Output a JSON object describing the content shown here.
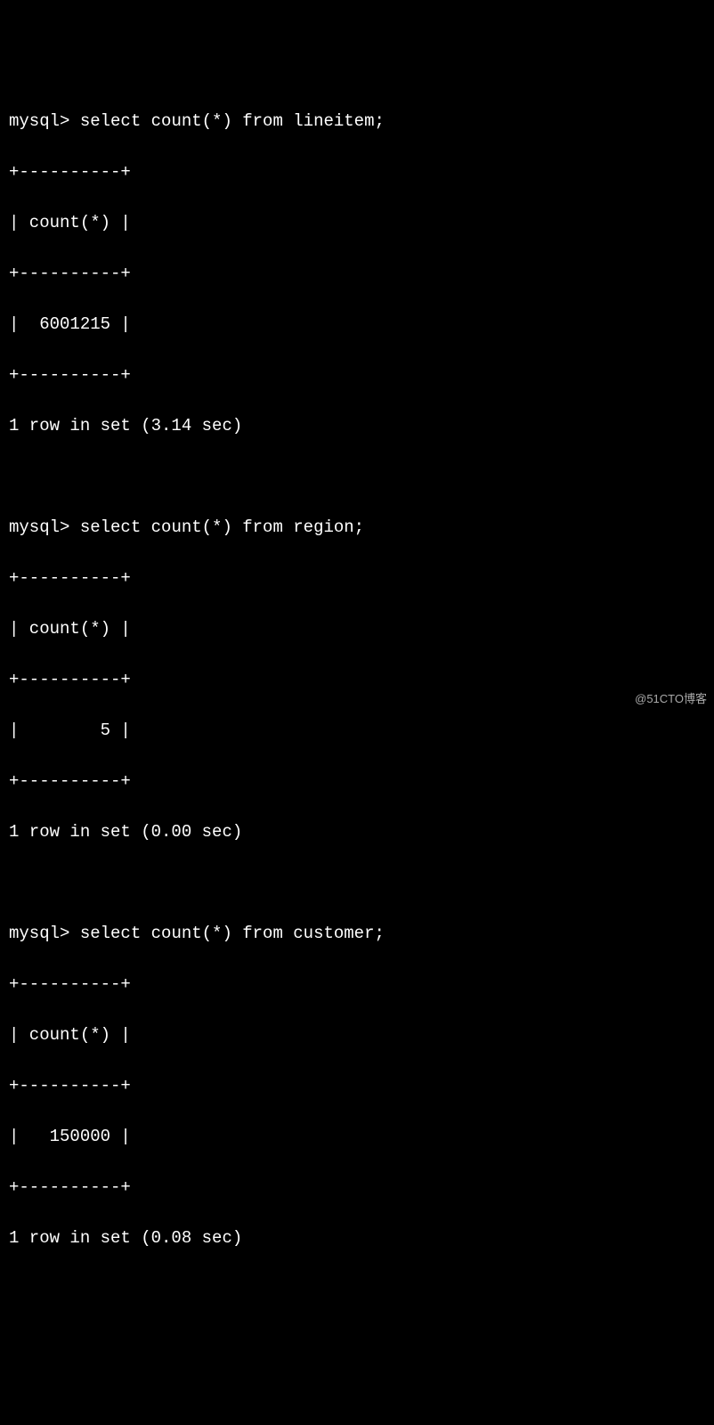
{
  "prompt": "mysql> ",
  "border": "+----------+",
  "header_row": "| count(*) |",
  "queries": [
    {
      "sql": "select count(*) from lineitem;",
      "value_row": "|  6001215 |",
      "summary": "1 row in set (3.14 sec)"
    },
    {
      "sql": "select count(*) from region;",
      "value_row": "|        5 |",
      "summary": "1 row in set (0.00 sec)"
    },
    {
      "sql": "select count(*) from customer;",
      "value_row": "|   150000 |",
      "summary": "1 row in set (0.08 sec)"
    }
  ],
  "watermark": "@51CTO博客"
}
